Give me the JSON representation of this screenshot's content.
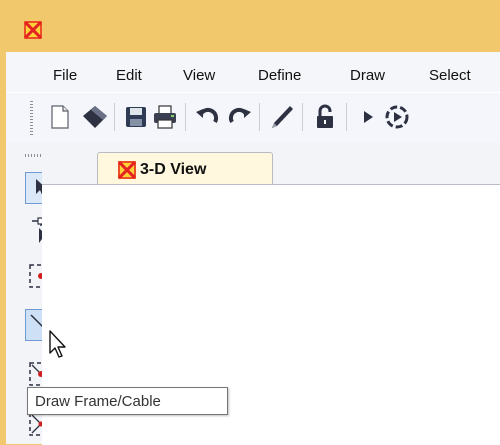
{
  "menu": {
    "items": [
      "File",
      "Edit",
      "View",
      "Define",
      "Draw",
      "Select"
    ]
  },
  "toolbar": {
    "icons": [
      "new-file-icon",
      "open-icon",
      "save-icon",
      "print-icon",
      "undo-icon",
      "redo-icon",
      "pencil-icon",
      "lock-open-icon",
      "run-icon",
      "run-analysis-icon"
    ]
  },
  "side_toolbar": {
    "icons": [
      "select-pointer-icon",
      "reshape-pointer-icon",
      "draw-point-icon",
      "draw-frame-icon",
      "draw-frame-point-icon",
      "draw-cross-icon"
    ]
  },
  "tabs": [
    {
      "label": "3-D View"
    }
  ],
  "tooltip": {
    "text": "Draw Frame/Cable"
  },
  "colors": {
    "title_bar": "#f1c86c",
    "chrome": "#f4f6fb",
    "selection_border": "#6f9ad6",
    "tab_bg": "#fff8df"
  }
}
